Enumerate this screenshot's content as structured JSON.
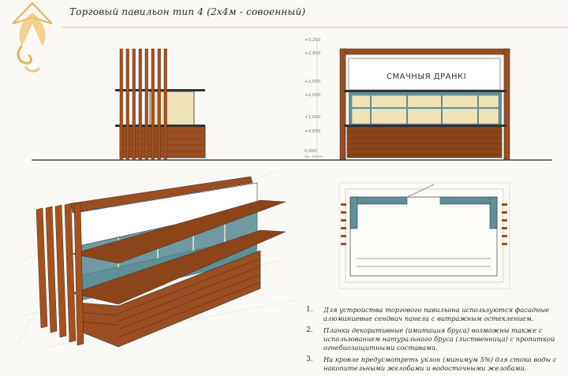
{
  "sheet": {
    "title": "Торговый павильон тип 4 (2х4м - совоенный)"
  },
  "elevation": {
    "sign_text": "СМАЧНЫЯ ДРАНКІ",
    "levels": [
      "+3,250",
      "+2,900",
      "+2,050",
      "+2,000",
      "+1,000",
      "+0,850",
      "0,000"
    ],
    "ground_label": "пр. земля"
  },
  "notes": [
    {
      "num": "1.",
      "text": "Для устройства торгового павильона используются фасадные алюминиевые сендвич панели с витражным остеклением."
    },
    {
      "num": "2.",
      "text": "Планки декоративные (имитация бруса) возможны также с использованием натурального бруса (лиственница) с пропиткой огнебиозащитными составами."
    },
    {
      "num": "3.",
      "text": "На кровле предусмотреть уклон (минимум 5%) для стока воды с накопительными желобами и водосточными желобами."
    }
  ],
  "colors": {
    "wood": "#9a4e22",
    "wood_dark": "#6b3415",
    "glass": "#5f8f98",
    "cream": "#efe3b8",
    "logo": "#e7b25a"
  }
}
